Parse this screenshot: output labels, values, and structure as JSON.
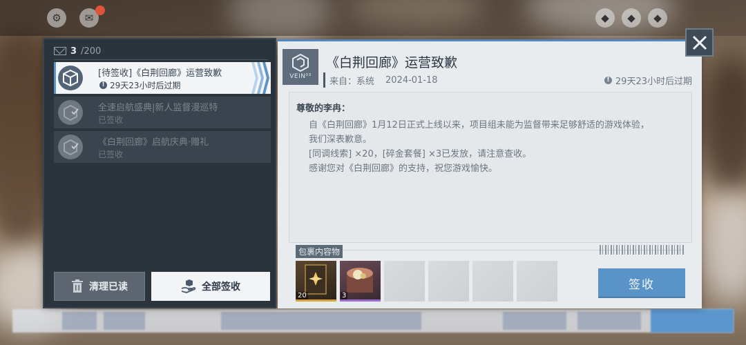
{
  "mail_list": {
    "count_current": "3",
    "count_total": "/200",
    "items": [
      {
        "title": "[待签收]《白荆回廊》运营致歉",
        "subtitle": "29天23小时后过期",
        "state": "active"
      },
      {
        "title": "全速启航盛典|新人监督漫巡特",
        "subtitle": "已签收",
        "state": "read"
      },
      {
        "title": "《白荆回廊》启航庆典·赠礼",
        "subtitle": "已签收",
        "state": "read"
      }
    ],
    "clear_read_label": "清理已读",
    "claim_all_label": "全部签收"
  },
  "detail": {
    "logo_text": "VEIN⁰³",
    "title": "《白荆回廊》运营致歉",
    "from_label": "来自：系统",
    "date": "2024-01-18",
    "expiry": "29天23小时后过期",
    "greeting": "尊敬的李冉：",
    "body_lines": [
      "自《白荆回廊》1月12日正式上线以来，项目组未能为监督带来足够舒适的游戏体验，",
      "我们深表歉意。",
      "[同调线索] ×20，[碎金套餐] ×3已发放，请注意查收。",
      "感谢您对《白荆回廊》的支持，祝您游戏愉快。"
    ],
    "attachments_label": "包裹内容物",
    "attachments": [
      {
        "qty": "20",
        "rarity_color": "#d6a33a"
      },
      {
        "qty": "3",
        "rarity_color": "#9a6ad6"
      }
    ],
    "claim_label": "签收"
  },
  "colors": {
    "accent": "#5a93c8",
    "panel_dark": "#2b333c",
    "panel_light": "#e9ecef"
  }
}
